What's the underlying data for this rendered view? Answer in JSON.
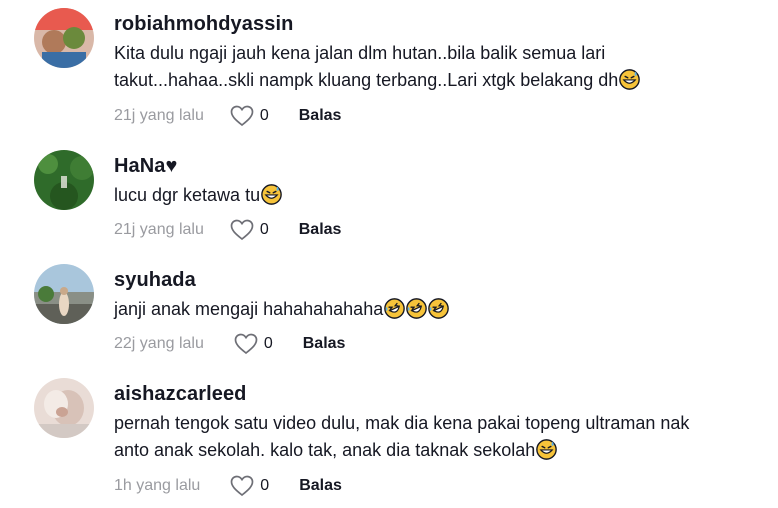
{
  "comments": [
    {
      "username": "robiahmohdyassin",
      "text_lines": [
        "Kita dulu ngaji jauh kena jalan dlm hutan..bila balik semua lari",
        "takut...hahaa..skli nampk kluang terbang..Lari xtgk belakang dh"
      ],
      "emojis": [
        "grinning-sweat"
      ],
      "time": "21j yang lalu",
      "likes": "0",
      "reply": "Balas"
    },
    {
      "username": "HaNa♥",
      "text_lines": [
        "lucu dgr ketawa tu"
      ],
      "emojis": [
        "grinning-sweat"
      ],
      "time": "21j yang lalu",
      "likes": "0",
      "reply": "Balas"
    },
    {
      "username": "syuhada",
      "text_lines": [
        "janji anak mengaji hahahahahaha"
      ],
      "emojis": [
        "rolling-laughing",
        "rolling-laughing",
        "rolling-laughing"
      ],
      "time": "22j yang lalu",
      "likes": "0",
      "reply": "Balas"
    },
    {
      "username": "aishazcarleed",
      "text_lines": [
        "pernah tengok satu video dulu, mak dia kena pakai topeng ultraman nak",
        "anto anak sekolah. kalo tak, anak dia taknak sekolah"
      ],
      "emojis": [
        "grinning-sweat"
      ],
      "time": "1h yang lalu",
      "likes": "0",
      "reply": "Balas"
    }
  ],
  "colors": {
    "text": "#161823",
    "muted": "#9a9ba0",
    "emoji_yellow": "#f6c33a"
  }
}
